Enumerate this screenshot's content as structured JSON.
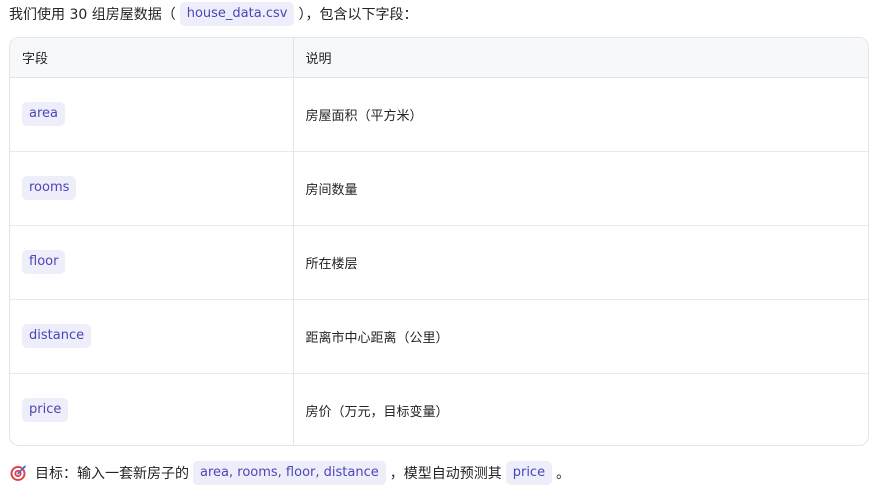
{
  "intro": {
    "prefix": "我们使用 30 组房屋数据（",
    "filename": "house_data.csv",
    "suffix": "），包含以下字段："
  },
  "table": {
    "headers": [
      "字段",
      "说明"
    ],
    "rows": [
      {
        "field": "area",
        "desc": "房屋面积（平方米）"
      },
      {
        "field": "rooms",
        "desc": "房间数量"
      },
      {
        "field": "floor",
        "desc": "所在楼层"
      },
      {
        "field": "distance",
        "desc": "距离市中心距离（公里）"
      },
      {
        "field": "price",
        "desc": "房价（万元，目标变量）"
      }
    ]
  },
  "goal": {
    "icon": "target-icon",
    "prefix": "目标：输入一套新房子的",
    "inputs": "area, rooms, floor, distance",
    "middle": "，模型自动预测其",
    "target": "price",
    "suffix": "。"
  },
  "colors": {
    "code_bg": "#eeedfa",
    "code_text": "#4a47b8",
    "header_bg": "#f7f8fa",
    "border": "#e3e4e8"
  }
}
